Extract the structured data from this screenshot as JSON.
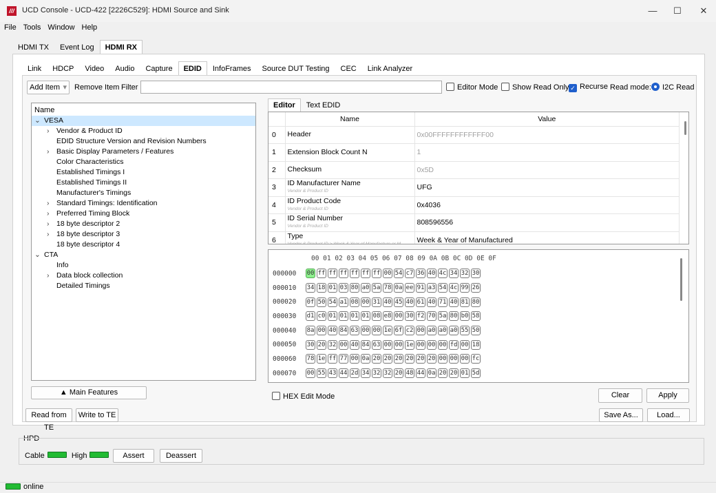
{
  "window": {
    "title": "UCD Console - UCD-422 [2226C529]: HDMI Source and Sink",
    "app_icon": "ucd-logo"
  },
  "menu": [
    "File",
    "Tools",
    "Window",
    "Help"
  ],
  "top_tabs": [
    "HDMI TX",
    "Event Log",
    "HDMI RX"
  ],
  "sub_tabs": [
    "Link",
    "HDCP",
    "Video",
    "Audio",
    "Capture",
    "EDID",
    "InfoFrames",
    "Source DUT Testing",
    "CEC",
    "Link Analyzer"
  ],
  "toolbar": {
    "add_item": "Add Item",
    "remove_item": "Remove Item",
    "filter_label": "Filter",
    "filter_value": "",
    "editor_mode": "Editor Mode",
    "show_read_only": "Show Read Only",
    "recurse": "Recurse",
    "read_mode_label": "Read mode:",
    "read_mode_value": "I2C Read"
  },
  "tree": {
    "header": "Name",
    "rows": [
      {
        "label": "VESA",
        "depth": 0,
        "expander": "v",
        "selected": true
      },
      {
        "label": "Vendor & Product ID",
        "depth": 1,
        "expander": ">"
      },
      {
        "label": "EDID Structure Version and Revision Numbers",
        "depth": 1,
        "expander": ""
      },
      {
        "label": "Basic Display Parameters / Features",
        "depth": 1,
        "expander": ">"
      },
      {
        "label": "Color Characteristics",
        "depth": 1,
        "expander": ""
      },
      {
        "label": "Established Timings I",
        "depth": 1,
        "expander": ""
      },
      {
        "label": "Established Timings II",
        "depth": 1,
        "expander": ""
      },
      {
        "label": "Manufacturer's Timings",
        "depth": 1,
        "expander": ""
      },
      {
        "label": "Standard Timings: Identification",
        "depth": 1,
        "expander": ">"
      },
      {
        "label": "Preferred Timing Block",
        "depth": 1,
        "expander": ">"
      },
      {
        "label": "18 byte descriptor 2",
        "depth": 1,
        "expander": ">"
      },
      {
        "label": "18 byte descriptor 3",
        "depth": 1,
        "expander": ">"
      },
      {
        "label": "18 byte descriptor 4",
        "depth": 1,
        "expander": ""
      },
      {
        "label": "CTA",
        "depth": 0,
        "expander": "v"
      },
      {
        "label": "Info",
        "depth": 1,
        "expander": ""
      },
      {
        "label": "Data block collection",
        "depth": 1,
        "expander": ">"
      },
      {
        "label": "Detailed Timings",
        "depth": 1,
        "expander": ""
      }
    ]
  },
  "main_features_button": "Main Features",
  "editor_tabs": [
    "Editor",
    "Text EDID"
  ],
  "grid": {
    "col_name": "Name",
    "col_value": "Value",
    "rows": [
      {
        "idx": "0",
        "name": "Header",
        "sub": "",
        "value": "0x00FFFFFFFFFFFF00",
        "dim": true
      },
      {
        "idx": "1",
        "name": "Extension Block Count N",
        "sub": "",
        "value": "1",
        "dim": true
      },
      {
        "idx": "2",
        "name": "Checksum",
        "sub": "",
        "value": "0x5D",
        "dim": true
      },
      {
        "idx": "3",
        "name": "ID Manufacturer Name",
        "sub": "Vendor & Product ID",
        "value": "UFG",
        "dim": false
      },
      {
        "idx": "4",
        "name": "ID Product Code",
        "sub": "Vendor & Product ID",
        "value": "0x4036",
        "dim": false
      },
      {
        "idx": "5",
        "name": "ID Serial Number",
        "sub": "Vendor & Product ID",
        "value": "808596556",
        "dim": false
      },
      {
        "idx": "6",
        "name": "Type",
        "sub": "Vendor & Product ID > Week & Year of Manufacture or M",
        "value": "Week & Year of Manufactured",
        "dim": false
      }
    ]
  },
  "hex": {
    "header": "00 01 02 03 04 05 06 07 08 09 0A 0B 0C 0D 0E 0F",
    "rows": [
      {
        "addr": "000000",
        "bytes": [
          "00",
          "ff",
          "ff",
          "ff",
          "ff",
          "ff",
          "ff",
          "00",
          "54",
          "c7",
          "36",
          "40",
          "4c",
          "34",
          "32",
          "30"
        ]
      },
      {
        "addr": "000010",
        "bytes": [
          "34",
          "18",
          "01",
          "03",
          "80",
          "a0",
          "5a",
          "78",
          "0a",
          "ee",
          "91",
          "a3",
          "54",
          "4c",
          "99",
          "26"
        ]
      },
      {
        "addr": "000020",
        "bytes": [
          "0f",
          "50",
          "54",
          "a1",
          "08",
          "00",
          "31",
          "40",
          "45",
          "40",
          "61",
          "40",
          "71",
          "40",
          "81",
          "80"
        ]
      },
      {
        "addr": "000030",
        "bytes": [
          "d1",
          "c0",
          "01",
          "01",
          "01",
          "01",
          "08",
          "e8",
          "00",
          "30",
          "f2",
          "70",
          "5a",
          "80",
          "b0",
          "58"
        ]
      },
      {
        "addr": "000040",
        "bytes": [
          "8a",
          "00",
          "40",
          "84",
          "63",
          "00",
          "00",
          "1e",
          "6f",
          "c2",
          "00",
          "a0",
          "a0",
          "a0",
          "55",
          "50"
        ]
      },
      {
        "addr": "000050",
        "bytes": [
          "30",
          "20",
          "32",
          "00",
          "40",
          "84",
          "63",
          "00",
          "00",
          "1e",
          "00",
          "00",
          "00",
          "fd",
          "00",
          "18"
        ]
      },
      {
        "addr": "000060",
        "bytes": [
          "78",
          "1e",
          "ff",
          "77",
          "00",
          "0a",
          "20",
          "20",
          "20",
          "20",
          "20",
          "20",
          "00",
          "00",
          "00",
          "fc"
        ]
      },
      {
        "addr": "000070",
        "bytes": [
          "00",
          "55",
          "43",
          "44",
          "2d",
          "34",
          "32",
          "32",
          "20",
          "48",
          "44",
          "0a",
          "20",
          "20",
          "01",
          "5d"
        ]
      }
    ]
  },
  "hex_edit_mode": "HEX Edit Mode",
  "clear_button": "Clear",
  "apply_button": "Apply",
  "read_from_te": "Read from TE",
  "write_to_te": "Write to TE",
  "save_as": "Save As...",
  "load": "Load...",
  "hpd": {
    "title": "HPD",
    "cable": "Cable",
    "high": "High",
    "assert": "Assert",
    "deassert": "Deassert"
  },
  "status": {
    "text": "online"
  },
  "colors": {
    "led_green": "#22bb33",
    "selected_hex": "#8ef08e",
    "check_blue": "#1f5fcc"
  }
}
